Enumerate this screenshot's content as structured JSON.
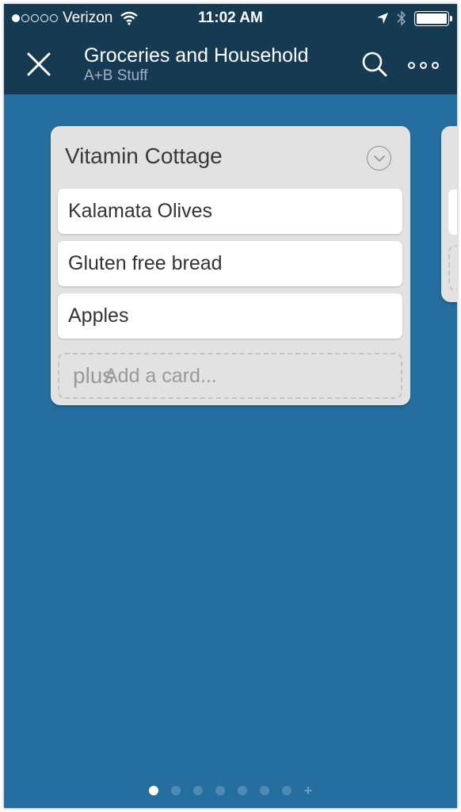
{
  "status_bar": {
    "carrier": "Verizon",
    "time": "11:02 AM",
    "signal_bars_filled": 1,
    "signal_bars_total": 5,
    "icons": [
      "wifi-icon",
      "location-arrow-icon",
      "bluetooth-icon",
      "battery-icon"
    ]
  },
  "header": {
    "title": "Groceries and Household",
    "subtitle": "A+B Stuff",
    "icons": [
      "close-icon",
      "search-icon",
      "more-icon"
    ]
  },
  "list": {
    "title": "Vitamin Cottage",
    "menu_icon": "chevron-down-circle-icon",
    "cards": [
      {
        "label": "Kalamata Olives"
      },
      {
        "label": "Gluten free bread"
      },
      {
        "label": "Apples"
      }
    ],
    "add_card": {
      "icon": "plus",
      "label": "Add a card..."
    }
  },
  "pager": {
    "count": 7,
    "active_index": 0,
    "add_icon": "+"
  },
  "colors": {
    "navbar": "#163a52",
    "board_background": "#246fa0",
    "list_background": "#e2e2e2",
    "card_background": "#ffffff"
  }
}
